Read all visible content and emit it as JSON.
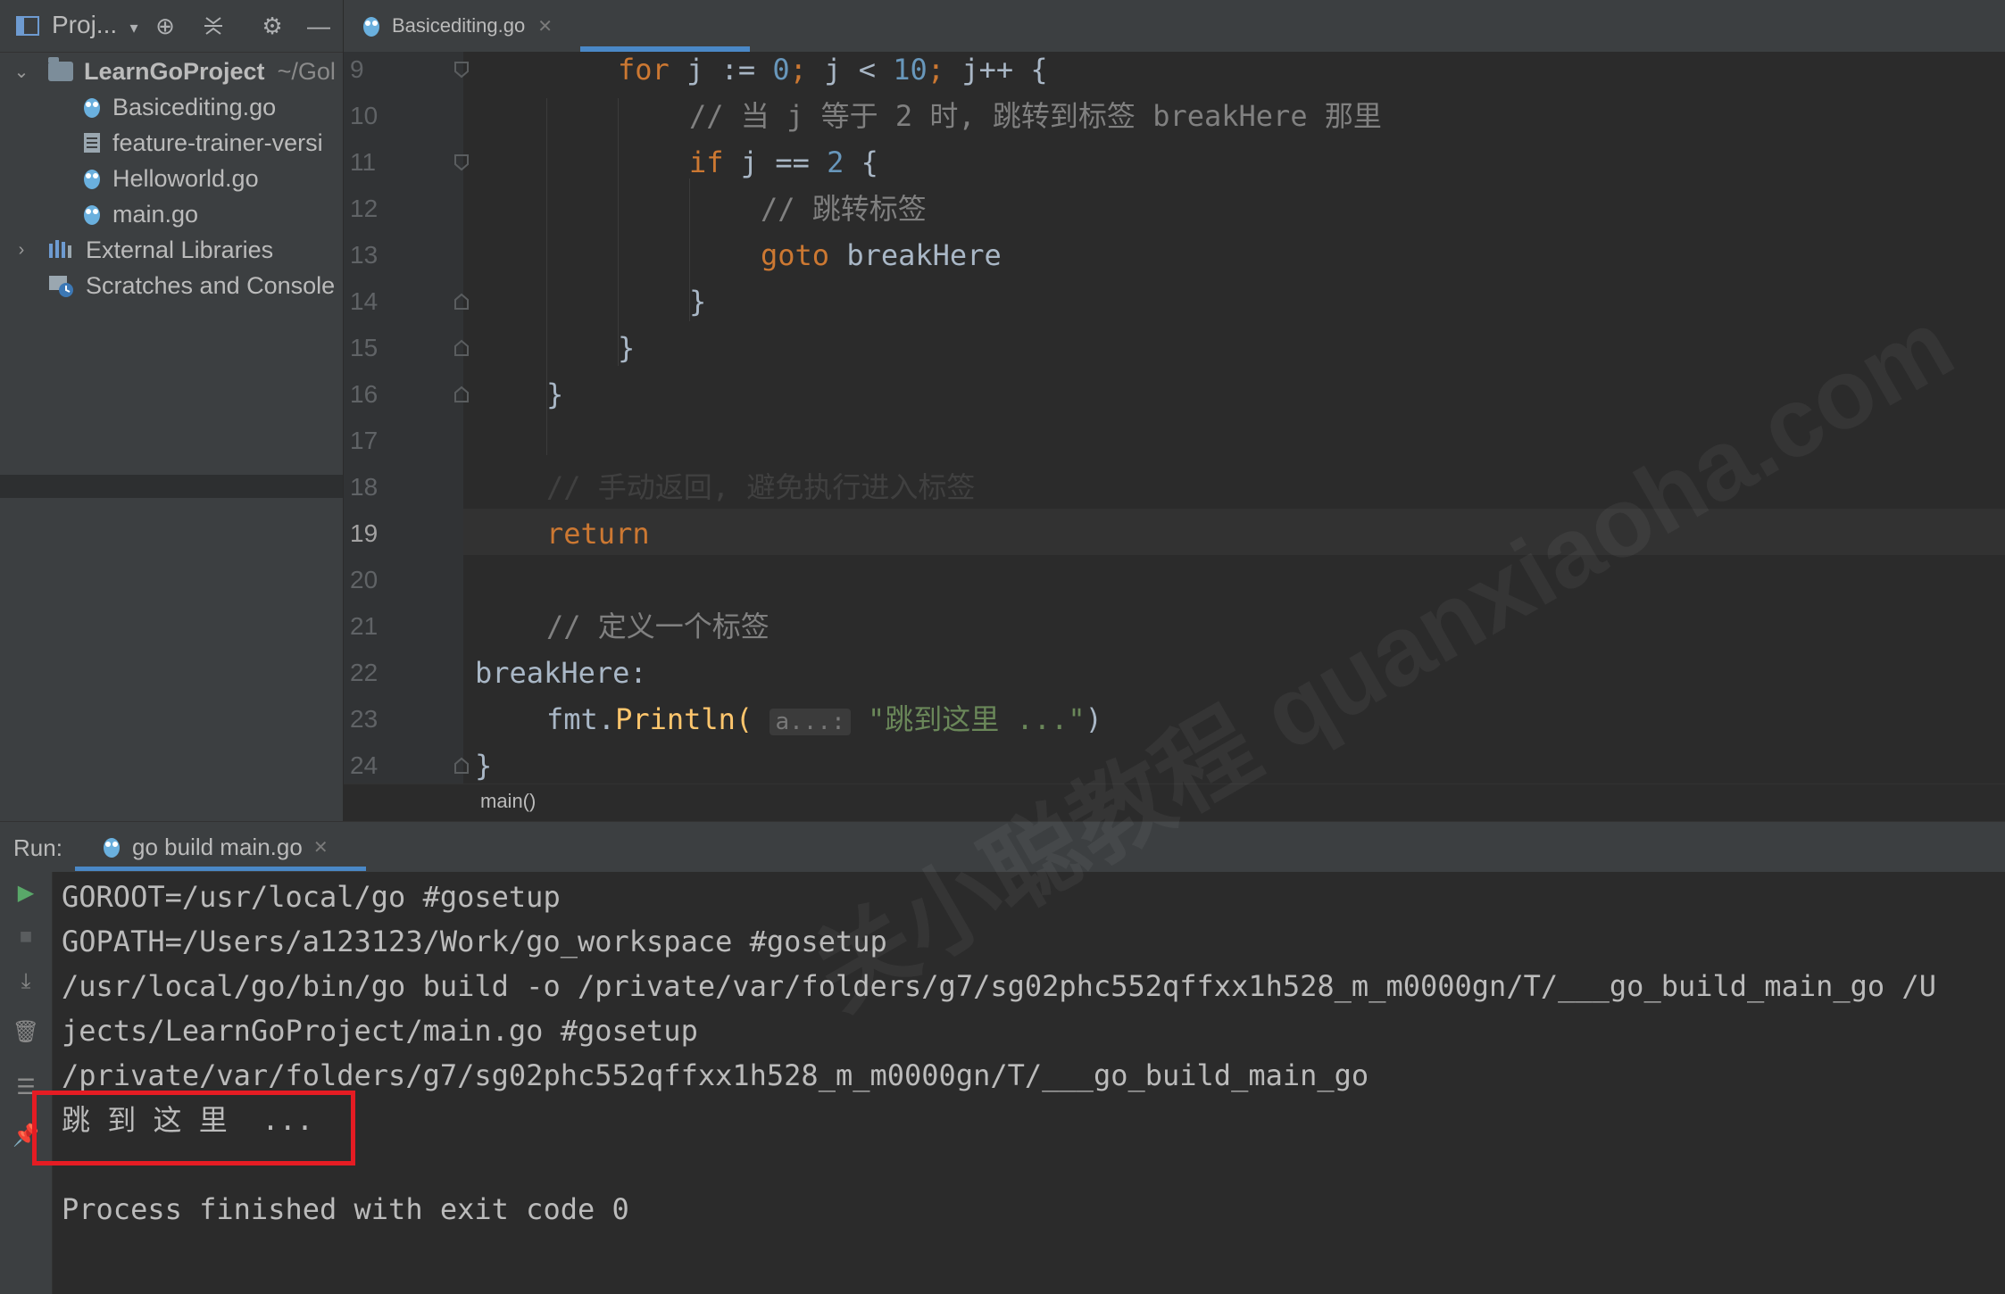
{
  "project_panel": {
    "title": "Proj...",
    "tree": [
      {
        "label": "LearnGoProject",
        "suffix": "~/Gol",
        "type": "project-root",
        "expanded": true
      },
      {
        "label": "Basicediting.go",
        "type": "go-file"
      },
      {
        "label": "feature-trainer-versi",
        "type": "text-file"
      },
      {
        "label": "Helloworld.go",
        "type": "go-file"
      },
      {
        "label": "main.go",
        "type": "go-file"
      },
      {
        "label": "External Libraries",
        "type": "libraries",
        "expanded": false
      },
      {
        "label": "Scratches and Console",
        "type": "scratches"
      }
    ]
  },
  "editor": {
    "tab_label": "Basicediting.go",
    "line_numbers": [
      "9",
      "10",
      "11",
      "12",
      "13",
      "14",
      "15",
      "16",
      "17",
      "18",
      "19",
      "20",
      "21",
      "22",
      "23",
      "24"
    ],
    "current_line": "19",
    "code": {
      "l9_for": "for",
      "l9_j1": "j",
      "l9_assign": ":=",
      "l9_zero": "0",
      "l9_semi1": ";",
      "l9_j2": "j",
      "l9_lt": "<",
      "l9_ten": "10",
      "l9_semi2": ";",
      "l9_inc": "j++",
      "l9_brace": "{",
      "l10_comment": "// 当 j 等于 2 时, 跳转到标签 breakHere 那里",
      "l11_if": "if",
      "l11_cond": "j ==",
      "l11_two": "2",
      "l11_brace": "{",
      "l12_comment": "// 跳转标签",
      "l13_goto": "goto",
      "l13_label": "breakHere",
      "l14": "}",
      "l15": "}",
      "l16": "}",
      "l18_comment": "// 手动返回, 避免执行进入标签",
      "l19_return": "return",
      "l21_comment": "// 定义一个标签",
      "l22_label": "breakHere:",
      "l23_pkg": "fmt.",
      "l23_fn": "Println(",
      "l23_hint": "a...:",
      "l23_str": "\"跳到这里 ...\"",
      "l23_close": ")",
      "l24": "}"
    },
    "breadcrumb": "main()"
  },
  "run_window": {
    "label": "Run:",
    "tab_label": "go build main.go",
    "output": [
      "GOROOT=/usr/local/go #gosetup",
      "GOPATH=/Users/a123123/Work/go_workspace #gosetup",
      "/usr/local/go/bin/go build -o /private/var/folders/g7/sg02phc552qffxx1h528_m_m0000gn/T/___go_build_main_go /U",
      "jects/LearnGoProject/main.go #gosetup",
      "/private/var/folders/g7/sg02phc552qffxx1h528_m_m0000gn/T/___go_build_main_go",
      "跳 到 这 里  ...",
      "",
      "Process finished with exit code 0"
    ]
  },
  "watermark": "关小聪教程 quanxiaoha.com",
  "colors": {
    "keyword": "#cc7832",
    "number": "#6897bb",
    "comment": "#808080",
    "string": "#6a8759",
    "function": "#ffc66d",
    "highlight_box": "#e51c23",
    "accent": "#4a88c7"
  }
}
